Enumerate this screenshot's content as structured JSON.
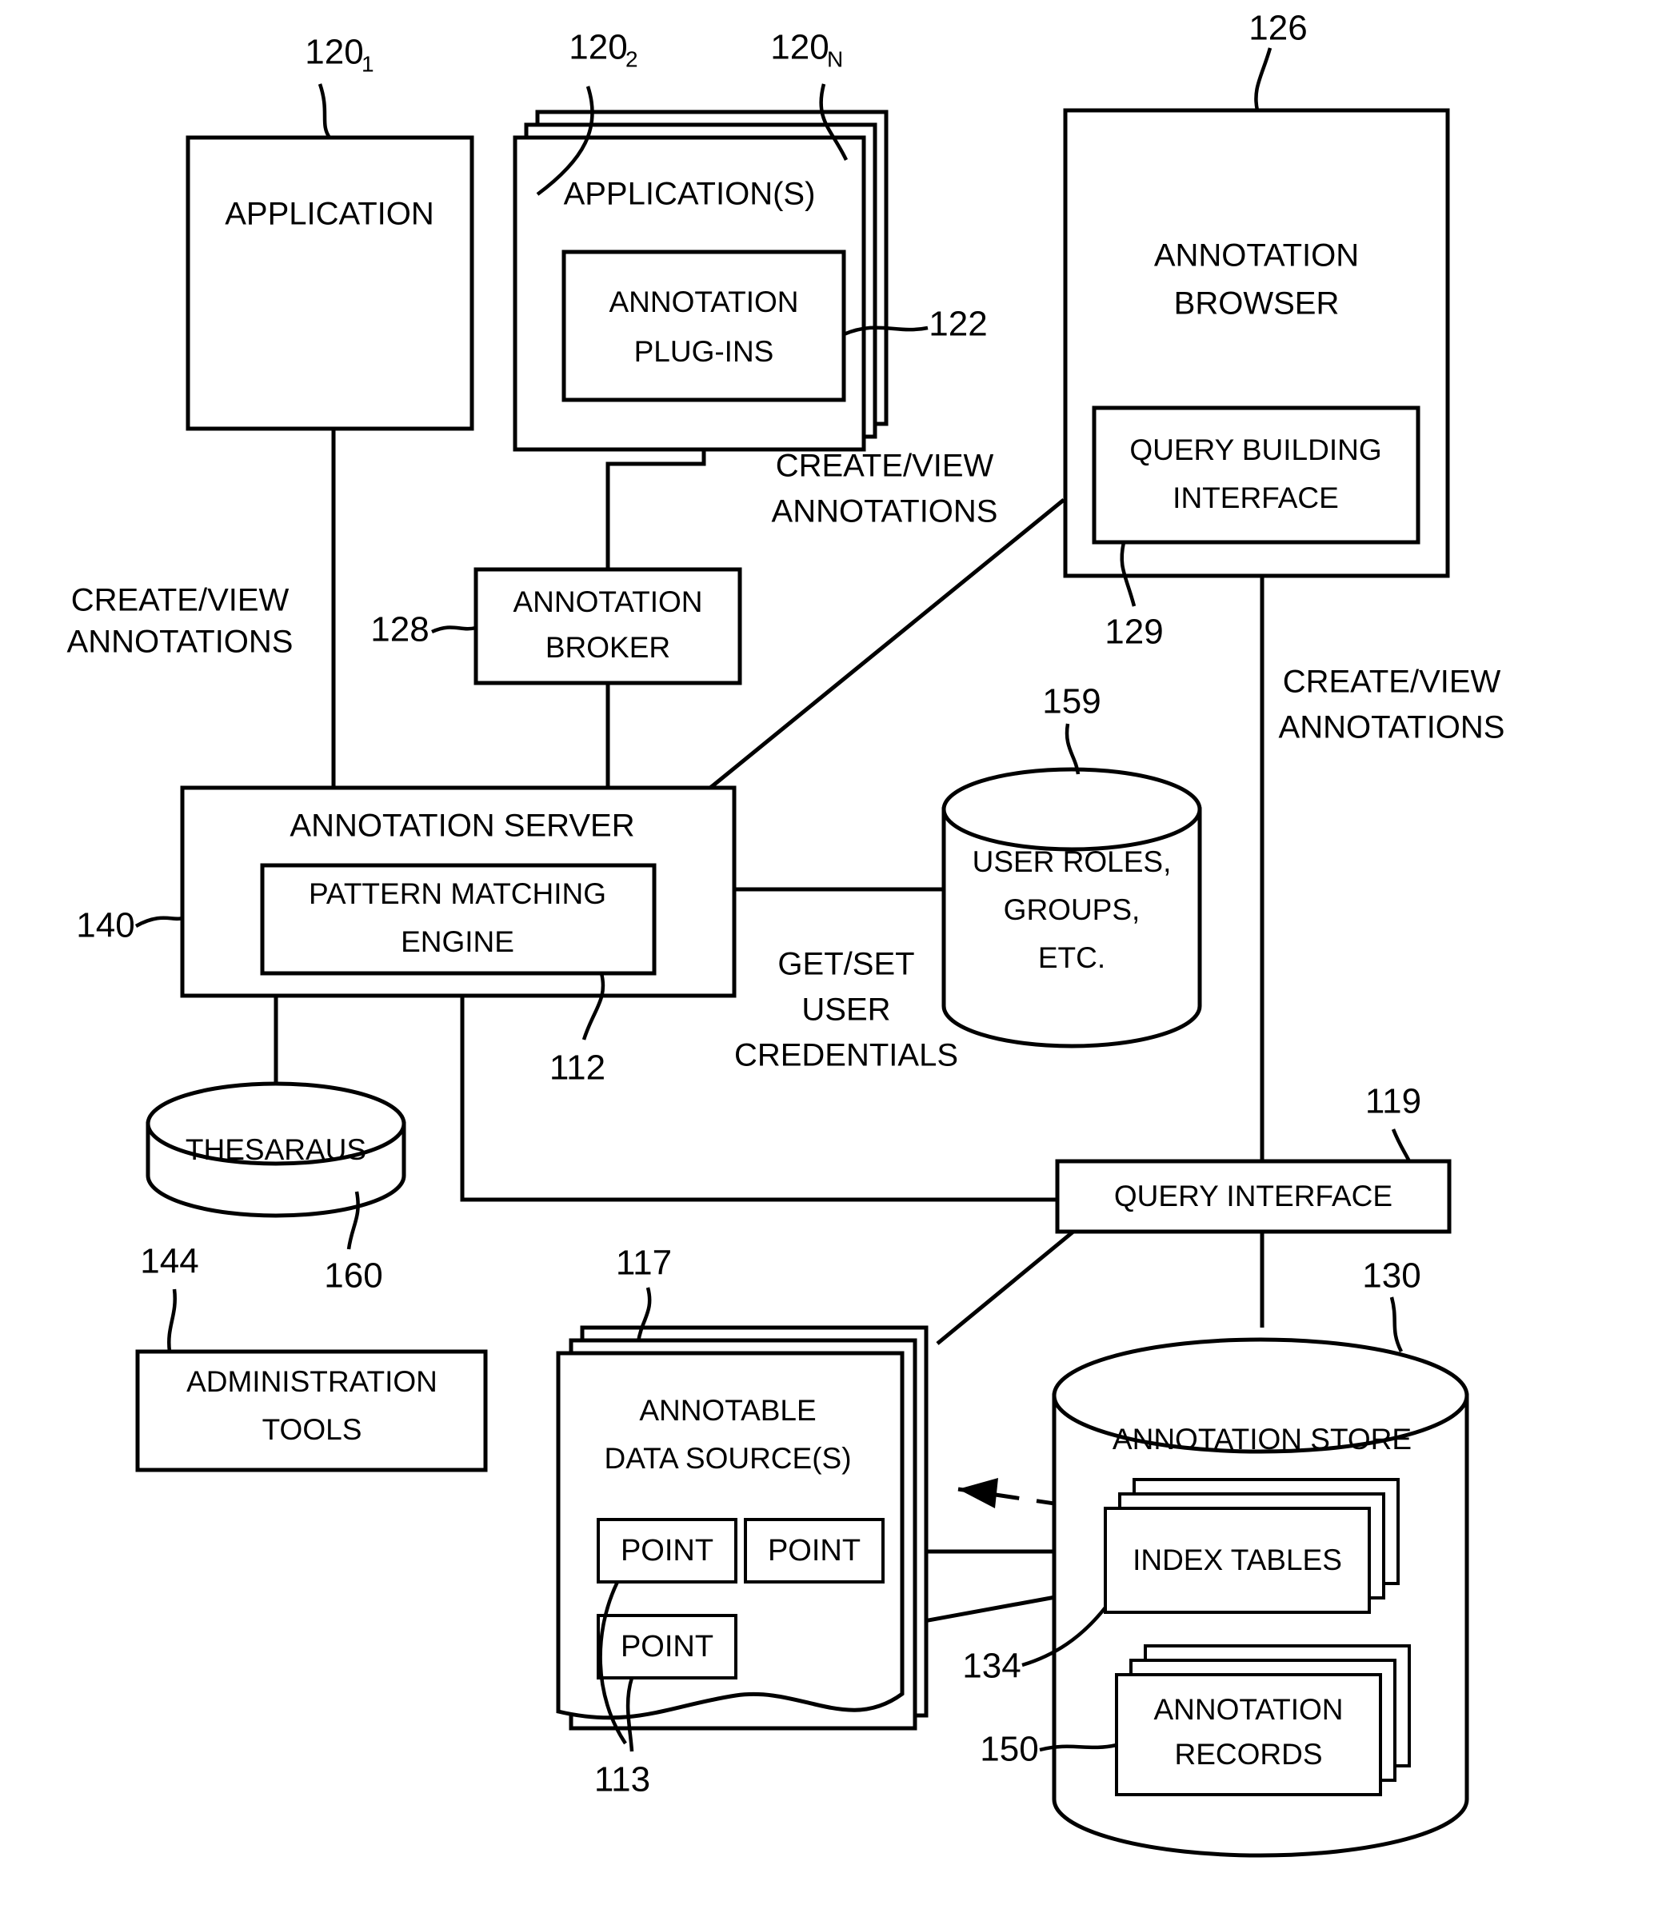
{
  "figure": {
    "type": "patent-system-block-diagram",
    "title": "Annotation system architecture"
  },
  "blocks": {
    "application": {
      "label": "APPLICATION",
      "ref": "120",
      "ref_sub": "1"
    },
    "applications": {
      "label": "APPLICATION(S)",
      "ref": "120",
      "ref_sub": "2",
      "ref_n": "120",
      "ref_n_sub": "N"
    },
    "annotation_plugins": {
      "line1": "ANNOTATION",
      "line2": "PLUG-INS",
      "ref": "122"
    },
    "annotation_browser": {
      "line1": "ANNOTATION",
      "line2": "BROWSER",
      "ref": "126"
    },
    "query_building_interface": {
      "line1": "QUERY BUILDING",
      "line2": "INTERFACE",
      "ref": "129"
    },
    "annotation_broker": {
      "line1": "ANNOTATION",
      "line2": "BROKER",
      "ref": "128"
    },
    "annotation_server": {
      "label": "ANNOTATION SERVER",
      "ref": "140"
    },
    "pattern_matching_engine": {
      "line1": "PATTERN MATCHING",
      "line2": "ENGINE",
      "ref": "112"
    },
    "user_roles": {
      "line1": "USER ROLES,",
      "line2": "GROUPS,",
      "line3": "ETC.",
      "ref": "159"
    },
    "thesaraus": {
      "label": "THESARAUS",
      "ref": "160"
    },
    "administration_tools": {
      "line1": "ADMINISTRATION",
      "line2": "TOOLS",
      "ref": "144"
    },
    "query_interface": {
      "label": "QUERY INTERFACE",
      "ref": "119"
    },
    "annotable_data_sources": {
      "line1": "ANNOTABLE",
      "line2": "DATA SOURCE(S)",
      "ref": "117"
    },
    "annotation_store": {
      "label": "ANNOTATION STORE",
      "ref": "130"
    },
    "index_tables": {
      "label": "INDEX TABLES",
      "ref": "134"
    },
    "annotation_records": {
      "line1": "ANNOTATION",
      "line2": "RECORDS",
      "ref": "150"
    },
    "points": {
      "label": "POINT",
      "ref": "113",
      "items": [
        "POINT",
        "POINT",
        "POINT"
      ]
    }
  },
  "flow_labels": {
    "create_view_left": {
      "line1": "CREATE/VIEW",
      "line2": "ANNOTATIONS"
    },
    "create_view_middle": {
      "line1": "CREATE/VIEW",
      "line2": "ANNOTATIONS"
    },
    "create_view_right": {
      "line1": "CREATE/VIEW",
      "line2": "ANNOTATIONS"
    },
    "get_set_credentials": {
      "line1": "GET/SET",
      "line2": "USER",
      "line3": "CREDENTIALS"
    }
  },
  "colors": {
    "ink": "#000000",
    "paper": "#ffffff"
  }
}
